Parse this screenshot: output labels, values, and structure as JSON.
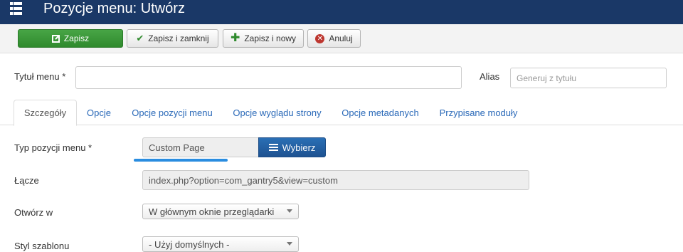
{
  "header": {
    "title": "Pozycje menu: Utwórz",
    "icon": "menu-list-icon"
  },
  "toolbar": {
    "save_label": "Zapisz",
    "save_close_label": "Zapisz i zamknij",
    "save_new_label": "Zapisz i nowy",
    "cancel_label": "Anuluj"
  },
  "form": {
    "title_label": "Tytuł menu *",
    "title_value": "",
    "alias_label": "Alias",
    "alias_placeholder": "Generuj z tytułu"
  },
  "tabs": [
    {
      "label": "Szczegóły",
      "active": true
    },
    {
      "label": "Opcje"
    },
    {
      "label": "Opcje pozycji menu"
    },
    {
      "label": "Opcje wyglądu strony"
    },
    {
      "label": "Opcje metadanych"
    },
    {
      "label": "Przypisane moduły"
    }
  ],
  "details": {
    "type_label": "Typ pozycji menu *",
    "type_value": "Custom Page",
    "choose_label": "Wybierz",
    "link_label": "Łącze",
    "link_value": "index.php?option=com_gantry5&view=custom",
    "open_label": "Otwórz w",
    "open_value": "W głównym oknie przeglądarki",
    "style_label": "Styl szablonu",
    "style_value": "- Użyj domyślnych -"
  },
  "colors": {
    "header_bg": "#1a3867",
    "save_green": "#3c9a3a",
    "primary_blue": "#2a6fb5",
    "highlight": "#2a8de0"
  }
}
